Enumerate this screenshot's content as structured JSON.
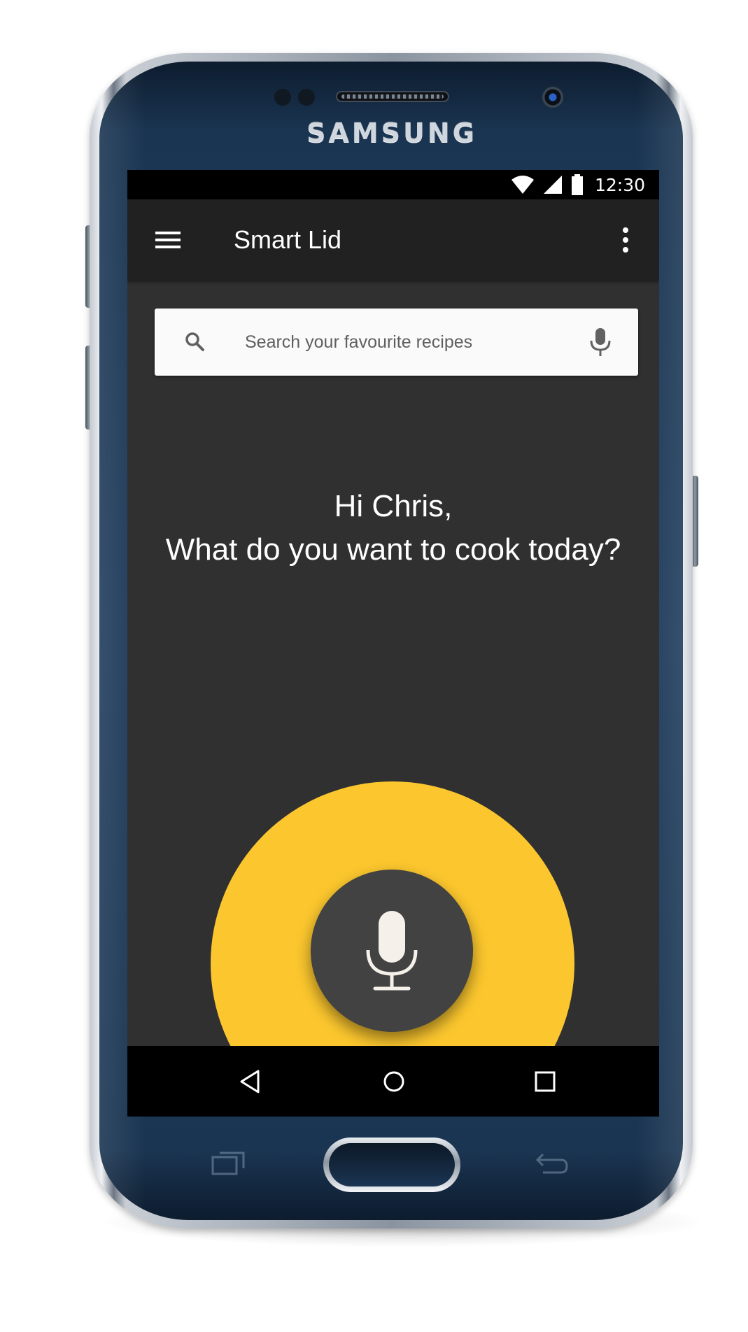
{
  "device": {
    "brand": "SAMSUNG",
    "body_color": "#1f3c5c"
  },
  "status_bar": {
    "time": "12:30",
    "icons": [
      "wifi-icon",
      "signal-icon",
      "battery-icon"
    ]
  },
  "app_bar": {
    "title": "Smart Lid",
    "left_icon": "menu-icon",
    "right_icon": "more-vert-icon",
    "background": "#212121"
  },
  "search": {
    "placeholder": "Search your favourite recipes",
    "leading_icon": "search-icon",
    "trailing_icon": "mic-icon"
  },
  "greeting": {
    "line1": "Hi Chris,",
    "line2": "What do you want to cook today?"
  },
  "voice": {
    "icon": "mic-icon",
    "accent_color": "#fcc72e",
    "button_color": "#424242"
  },
  "nav_bar": {
    "buttons": [
      "back-icon",
      "home-icon",
      "recents-icon"
    ]
  },
  "colors": {
    "screen_background": "#303030",
    "accent": "#fcc72e"
  }
}
